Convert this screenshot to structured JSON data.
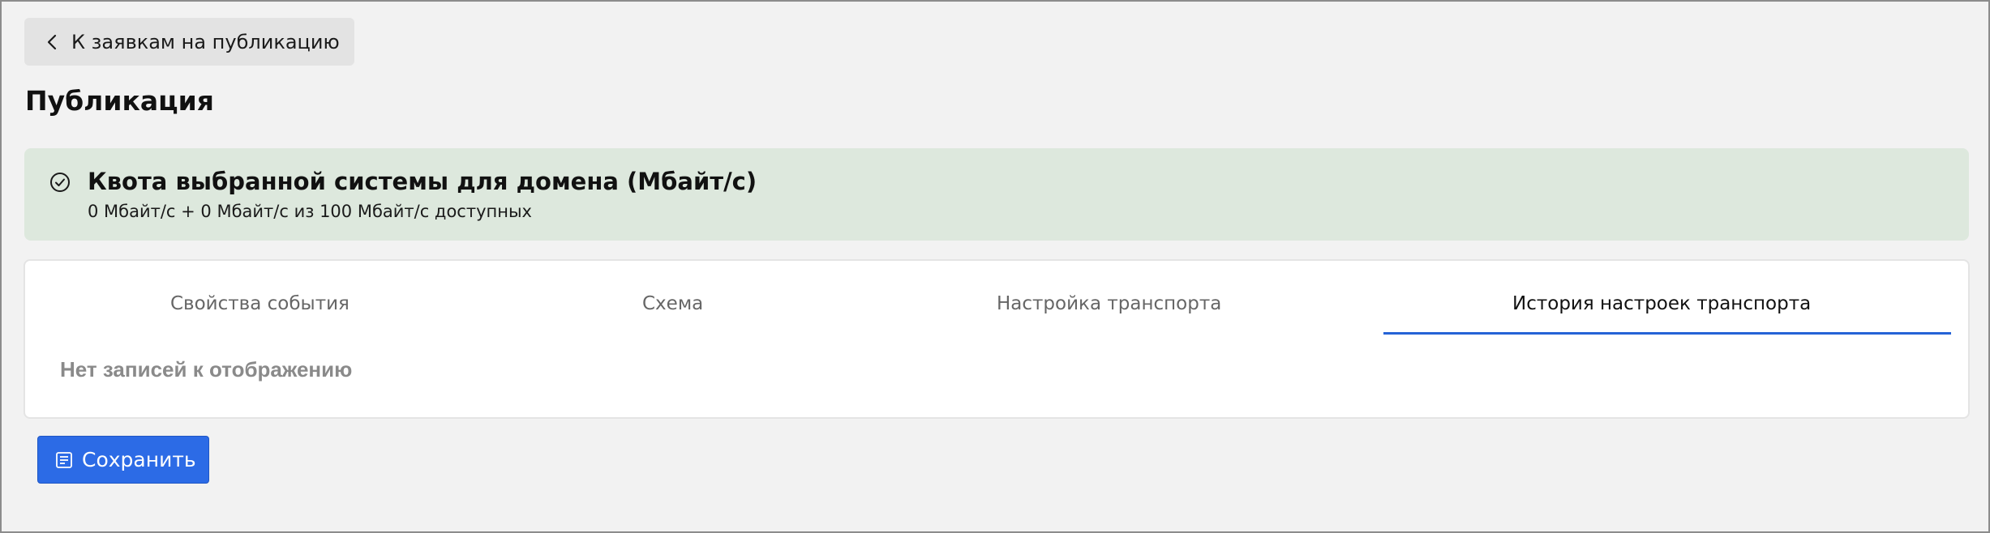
{
  "back_link": {
    "label": "К заявкам на публикацию",
    "icon": "chevron-left-icon"
  },
  "page_title": "Публикация",
  "quota": {
    "icon": "check-circle-icon",
    "title": "Квота выбранной системы для домена (Мбайт/с)",
    "subtitle": "0 Мбайт/с + 0 Мбайт/с из 100 Мбайт/с доступных",
    "background_color": "#dde8dd"
  },
  "tabs": [
    {
      "label": "Свойства события",
      "active": false
    },
    {
      "label": "Схема",
      "active": false
    },
    {
      "label": "Настройка транспорта",
      "active": false
    },
    {
      "label": "История настроек транспорта",
      "active": true
    }
  ],
  "empty_message": "Нет записей к отображению",
  "save_button": {
    "label": "Сохранить",
    "icon": "save-icon",
    "color": "#2c6be6"
  },
  "accent_color": "#2563d6"
}
